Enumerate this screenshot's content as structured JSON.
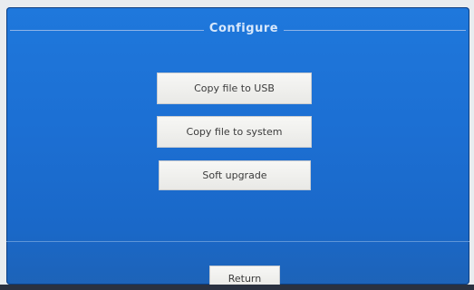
{
  "screen": {
    "title": "Configure"
  },
  "buttons": {
    "copy_to_usb": "Copy file to USB",
    "copy_to_system": "Copy file to system",
    "soft_upgrade": "Soft upgrade",
    "return": "Return"
  },
  "colors": {
    "background": "#1c6fd3",
    "button_face": "#f0f0ee",
    "button_text": "#3b3b3b",
    "title_text": "#d8e8fb"
  }
}
